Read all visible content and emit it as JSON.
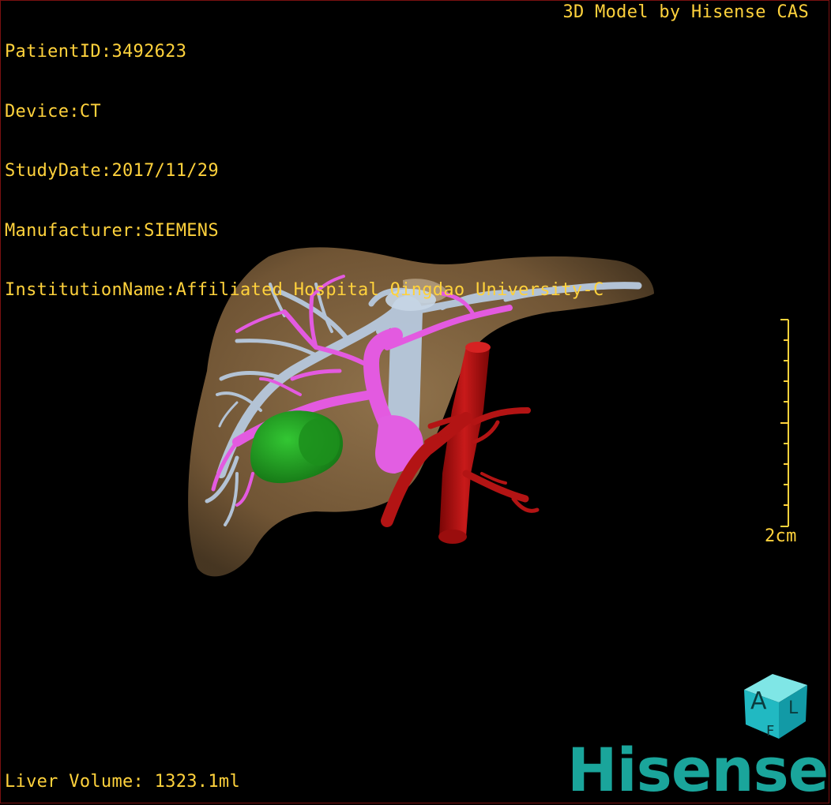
{
  "header": {
    "patient_id": "PatientID:3492623",
    "device": "Device:CT",
    "study_date": "StudyDate:2017/11/29",
    "manufacturer": "Manufacturer:SIEMENS",
    "institution": "InstitutionName:Affiliated Hospital Qingdao University-C"
  },
  "credit": "3D Model by Hisense CAS",
  "footer": {
    "liver_volume": "Liver Volume: 1323.1ml"
  },
  "scale_bar": {
    "label": "2cm"
  },
  "orientation_cube": {
    "front_letter": "A",
    "side_letter": "L",
    "bottom_letter": "F"
  },
  "brand": {
    "logo_text": "Hisense"
  },
  "colors": {
    "overlay_text": "#ffd23c",
    "liver": "#8a6a44",
    "portal_vein": "#b7c9de",
    "hepatic_artery": "#e35ae0",
    "lesion": "#1f9b1f",
    "aorta": "#b11313",
    "brand": "#1aa59b"
  }
}
